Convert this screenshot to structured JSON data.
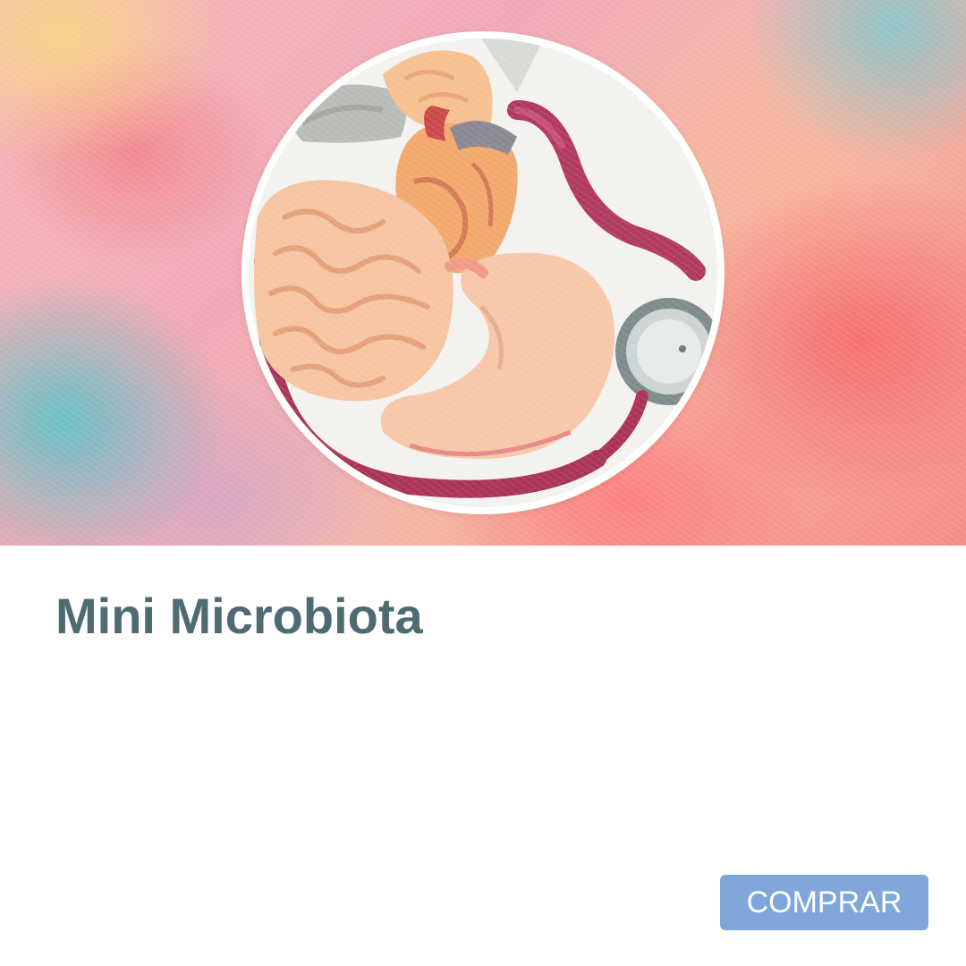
{
  "product": {
    "title": "Mini Microbiota",
    "image_alt": "Anatomical models of brain, heart and stomach with a stethoscope"
  },
  "actions": {
    "buy_label": "COMPRAR"
  },
  "colors": {
    "title": "#4f6b72",
    "button_bg": "#7fa7d9",
    "button_text": "#ffffff",
    "background": "#ffffff"
  }
}
